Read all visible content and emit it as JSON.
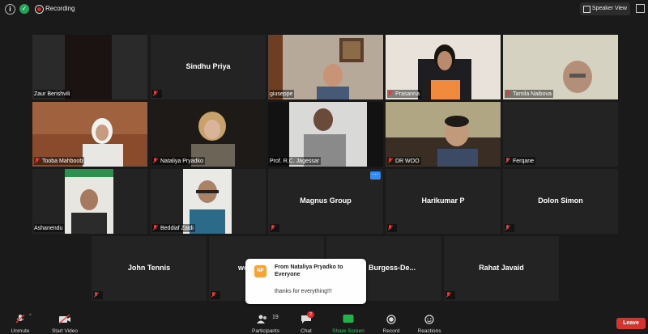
{
  "topbar": {
    "recording_label": "Recording",
    "view_button": "Speaker View"
  },
  "tiles": [
    {
      "name": "Zaur Berishvili"
    },
    {
      "name": "Sindhu Priya",
      "big_name": "Sindhu Priya"
    },
    {
      "name": "giuseppe"
    },
    {
      "name": "Prasanna"
    },
    {
      "name": "Tamila Naibova"
    },
    {
      "name": "Tooba Mahboob"
    },
    {
      "name": "Nataliya Pryadko"
    },
    {
      "name": "Prof. R.C. Jagessar"
    },
    {
      "name": "DR WOO"
    },
    {
      "name": "Ferqane"
    },
    {
      "name": "Ashanendu"
    },
    {
      "name": "Beddiaf Zaidi"
    },
    {
      "big_name": "Magnus Group"
    },
    {
      "big_name": "Harikumar P"
    },
    {
      "big_name": "Dolon Simon"
    },
    {
      "big_name": "John Tennis"
    },
    {
      "big_name": "wo"
    },
    {
      "big_name": "Burgess-De..."
    },
    {
      "big_name": "Rahat Javaid"
    }
  ],
  "chat": {
    "avatar_initials": "NP",
    "from": "From Nataliya Pryadko to Everyone",
    "message": "thanks for everything!!!"
  },
  "toolbar": {
    "unmute": "Unmute",
    "start_video": "Start Video",
    "participants": "Participants",
    "participant_count": "19",
    "chat": "Chat",
    "chat_badge": "2",
    "share_screen": "Share Screen",
    "record": "Record",
    "reactions": "Reactions",
    "leave": "Leave"
  },
  "colors": {
    "active_speaker": "#c8e042",
    "share": "#23b14d",
    "leave": "#d6332d",
    "muted": "#e03b3b"
  }
}
